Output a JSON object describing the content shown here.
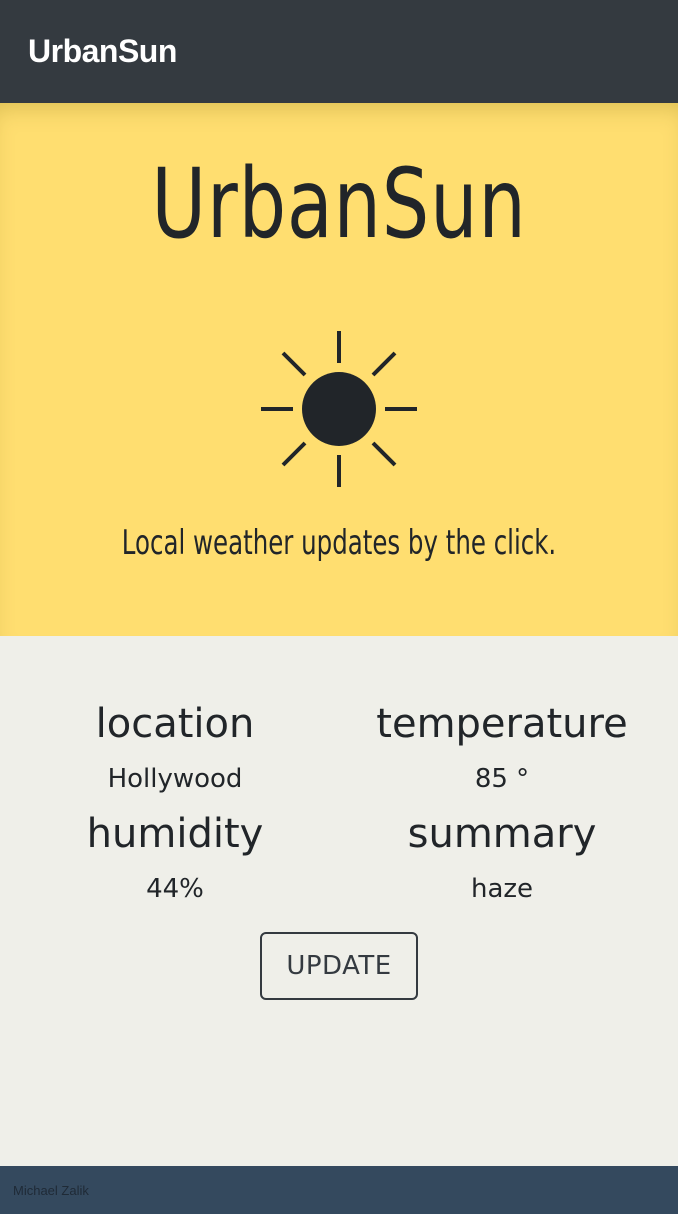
{
  "navbar": {
    "brand": "UrbanSun"
  },
  "hero": {
    "title": "UrbanSun",
    "icon": "sun-icon",
    "tagline": "Local weather updates by the click."
  },
  "weather": {
    "location": {
      "label": "location",
      "value": "Hollywood"
    },
    "temperature": {
      "label": "temperature",
      "value": "85 °"
    },
    "humidity": {
      "label": "humidity",
      "value": "44%"
    },
    "summary": {
      "label": "summary",
      "value": "haze"
    }
  },
  "actions": {
    "update_label": "UPDATE"
  },
  "footer": {
    "author": "Michael Zalik"
  },
  "colors": {
    "navbar_bg": "#343a40",
    "hero_bg": "#ffde70",
    "content_bg": "#efefe9",
    "footer_bg": "#34495e",
    "text": "#212529"
  }
}
